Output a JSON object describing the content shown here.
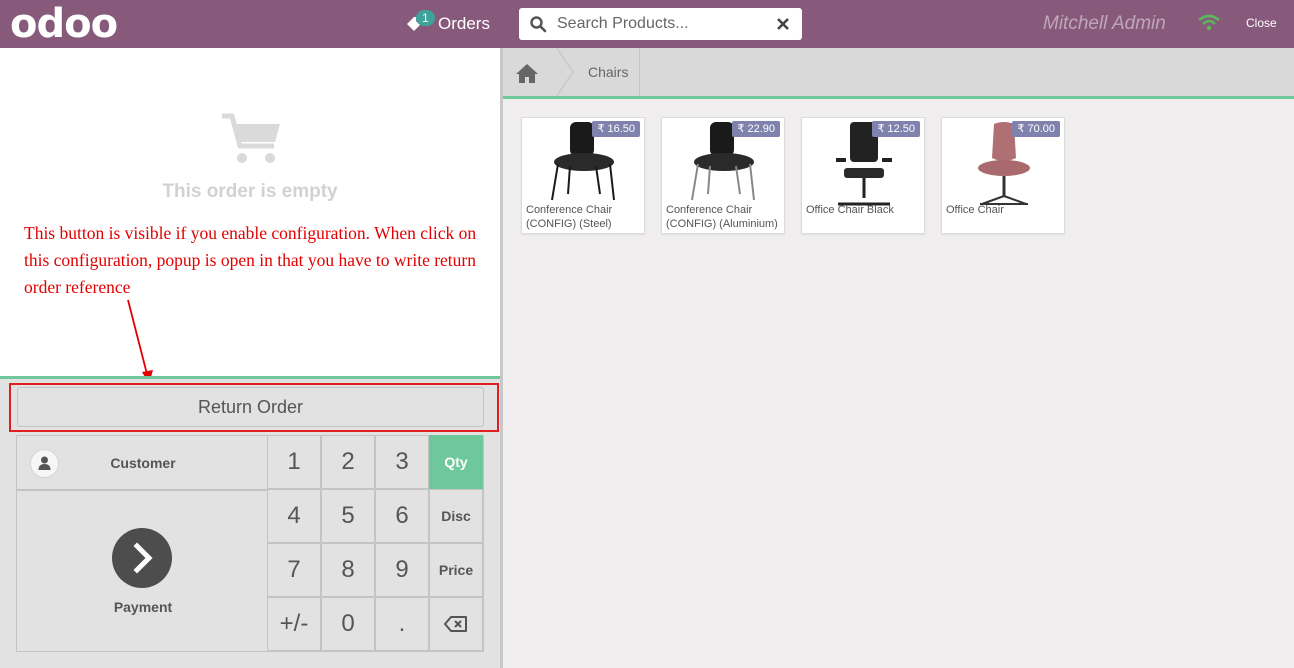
{
  "header": {
    "logo_text": "odoo",
    "orders_label": "Orders",
    "orders_badge": "1",
    "search_placeholder": "Search Products...",
    "username": "Mitchell Admin",
    "close_label": "Close",
    "brand_color": "#875a7b"
  },
  "order": {
    "empty_text": "This order is empty",
    "annotation": "This button is visible if you enable configuration. When click on this configuration, popup is open in that you have to write return order reference",
    "return_order_label": "Return Order"
  },
  "pad": {
    "customer_label": "Customer",
    "payment_label": "Payment",
    "keys": [
      "1",
      "2",
      "3",
      "4",
      "5",
      "6",
      "7",
      "8",
      "9",
      "+/-",
      "0",
      "."
    ],
    "modes": [
      "Qty",
      "Disc",
      "Price"
    ],
    "active_mode": "Qty",
    "accent_color": "#6ec89b"
  },
  "breadcrumb": {
    "category": "Chairs"
  },
  "products": [
    {
      "name": "Conference Chair (CONFIG) (Steel)",
      "price": "₹ 16.50"
    },
    {
      "name": "Conference Chair (CONFIG) (Aluminium)",
      "price": "₹ 22.90"
    },
    {
      "name": "Office Chair Black",
      "price": "₹ 12.50"
    },
    {
      "name": "Office Chair",
      "price": "₹ 70.00"
    }
  ]
}
